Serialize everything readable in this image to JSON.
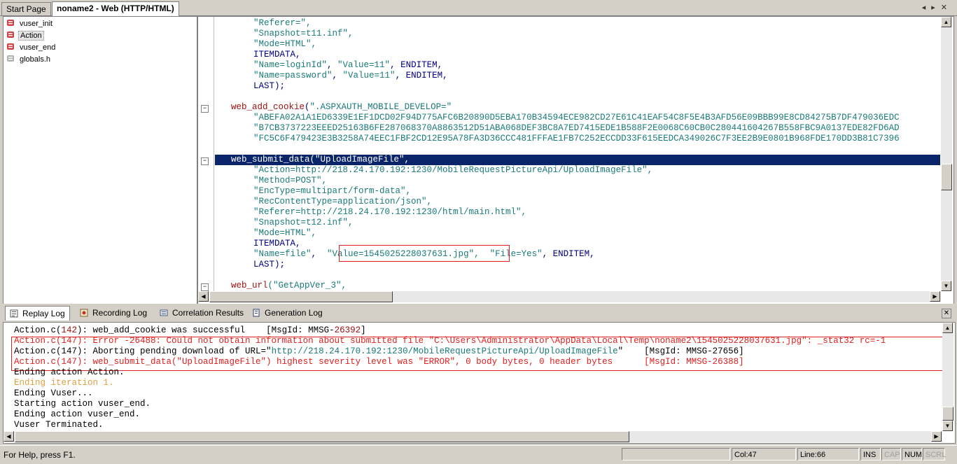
{
  "doc_tabs": [
    "Start Page",
    "noname2 - Web (HTTP/HTML)"
  ],
  "tree": [
    {
      "label": "vuser_init"
    },
    {
      "label": "Action"
    },
    {
      "label": "vuser_end"
    },
    {
      "label": "globals.h"
    }
  ],
  "code": {
    "l1": "\"Referer=\",",
    "l2": "\"Snapshot=t11.inf\",",
    "l3": "\"Mode=HTML\",",
    "l4": "ITEMDATA,",
    "l5a": "\"Name=loginId\"",
    "l5b": "\"Value=11\"",
    "l5c": "ENDITEM,",
    "l6a": "\"Name=password\"",
    "l6b": "\"Value=11\"",
    "l6c": "ENDITEM,",
    "l7": "LAST);",
    "cookie_fn": "web_add_cookie",
    "cookie_arg": "\".ASPXAUTH_MOBILE_DEVELOP=\"",
    "cookie1": "\"ABEFA02A1A1ED6339E1EF1DCD02F94D775AFC6B20890D5EBA170B34594ECE982CD27E61C41EAF54C8F5E4B3AFD56E09BBB99E8CD84275B7DF479036EDC",
    "cookie2": "\"B7CB3737223EEED25163B6FE287068370A8863512D51ABA068DEF3BC8A7ED7415EDE1B588F2E0068C60CB0C280441604267B558FBC9A0137EDE82FD6AD",
    "cookie3": "\"FC5C6F479423E3B3258A74EEC1FBF2CD12E95A78FA3D36CCC481FFFAE1FB7C252ECCDD33F615EEDCA349026C7F3EE2B9E0801B968FDE170DD3B81C7396",
    "submit_fn": "web_submit_data",
    "submit_arg": "(\"UploadImageFile\",",
    "s1": "\"Action=http://218.24.170.192:1230/MobileRequestPictureApi/UploadImageFile\",",
    "s2": "\"Method=POST\",",
    "s3": "\"EncType=multipart/form-data\",",
    "s4": "\"RecContentType=application/json\",",
    "s5": "\"Referer=http://218.24.170.192:1230/html/main.html\",",
    "s6": "\"Snapshot=t12.inf\",",
    "s7": "\"Mode=HTML\",",
    "s8": "ITEMDATA,",
    "s9a": "\"Name=file\"",
    "s9b": "\"Value=1545025228037631.jpg\",",
    "s9c": "\"File=Yes\"",
    "s9d": "ENDITEM,",
    "s10": "LAST);",
    "url_fn": "web_url",
    "url_arg": "(\"GetAppVer_3\","
  },
  "output_tabs": [
    "Replay Log",
    "Recording Log",
    "Correlation Results",
    "Generation Log"
  ],
  "log": {
    "l1a": "Action.c(",
    "l1n": "142",
    "l1b": "): web_add_cookie was successful    [MsgId: MMSG-",
    "l1m": "26392",
    "l1c": "]",
    "l2": "Action.c(147): Error -26488: Could not obtain information about submitted file \"C:\\Users\\Administrator\\AppData\\Local\\Temp\\noname2\\1545025228037631.jpg\": _stat32 rc=-1",
    "l3a": "Action.c(147): Aborting pending download of URL=\"",
    "l3u": "http://218.24.170.192:1230/MobileRequestPictureApi/UploadImageFile",
    "l3b": "\"    [MsgId: MMSG-27656]",
    "l4": "Action.c(147): web_submit_data(\"UploadImageFile\") highest severity level was \"ERROR\", 0 body bytes, 0 header bytes      [MsgId: MMSG-26388]",
    "l5": "Ending action Action.",
    "l6": "Ending iteration 1.",
    "l7": "Ending Vuser...",
    "l8": "Starting action vuser_end.",
    "l9": "Ending action vuser_end.",
    "l10": "Vuser Terminated."
  },
  "status": {
    "help": "For Help, press F1.",
    "col": "Col:47",
    "line": "Line:66",
    "ins": "INS",
    "cap": "CAP",
    "num": "NUM",
    "scrl": "SCRL"
  }
}
